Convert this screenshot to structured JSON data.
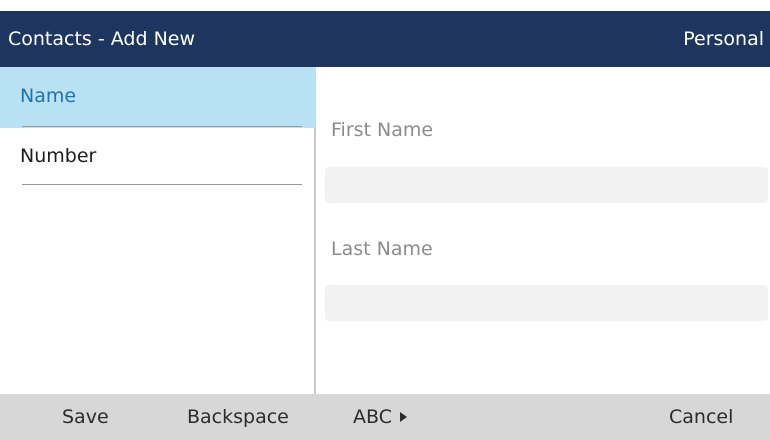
{
  "header": {
    "title": "Contacts - Add New",
    "category": "Personal"
  },
  "sidebar": {
    "items": [
      {
        "label": "Name",
        "selected": true
      },
      {
        "label": "Number",
        "selected": false
      }
    ]
  },
  "form": {
    "first_name_label": "First Name",
    "first_name_value": "",
    "last_name_label": "Last Name",
    "last_name_value": ""
  },
  "softkeys": {
    "save": "Save",
    "backspace": "Backspace",
    "mode": "ABC",
    "cancel": "Cancel"
  },
  "colors": {
    "header_bg": "#1e3560",
    "selected_bg": "#b8e1f3",
    "selected_text": "#1f73ae",
    "softkey_bg": "#d7d7d7"
  }
}
